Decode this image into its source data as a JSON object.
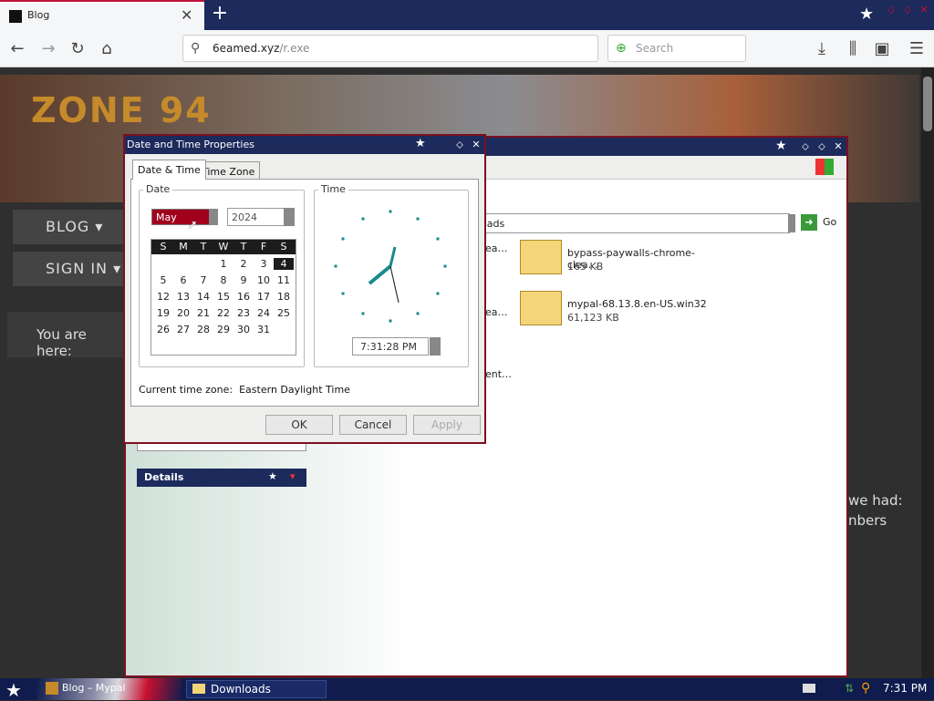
{
  "browser": {
    "tab_title": "Blog",
    "url_host": "6eamed.xyz",
    "url_path": "/r.exe",
    "search_placeholder": "Search"
  },
  "site": {
    "logo": "ZONE 94",
    "nav_blog": "BLOG",
    "nav_signin": "SIGN IN",
    "breadcrumb": "You are here:",
    "side_text_1": "we had:",
    "side_text_2": "nbers"
  },
  "explorer": {
    "address": "oads",
    "go_label": "Go",
    "left_fragment_1": "ea…",
    "left_fragment_2": "ea…",
    "left_fragment_3": "ent…",
    "files": [
      {
        "name": "bypass-paywalls-chrome-clea…",
        "size": "165 KB"
      },
      {
        "name": "mypal-68.13.8.en-US.win32",
        "size": "61,123 KB"
      }
    ],
    "details_label": "Details"
  },
  "dialog": {
    "title": "Date and Time Properties",
    "tabs": [
      "Date & Time",
      "Time Zone"
    ],
    "date_group": "Date",
    "time_group": "Time",
    "month": "May",
    "year": "2024",
    "weekdays": [
      "S",
      "M",
      "T",
      "W",
      "T",
      "F",
      "S"
    ],
    "weeks": [
      [
        "",
        "",
        "",
        "1",
        "2",
        "3",
        "4"
      ],
      [
        "5",
        "6",
        "7",
        "8",
        "9",
        "10",
        "11"
      ],
      [
        "12",
        "13",
        "14",
        "15",
        "16",
        "17",
        "18"
      ],
      [
        "19",
        "20",
        "21",
        "22",
        "23",
        "24",
        "25"
      ],
      [
        "26",
        "27",
        "28",
        "29",
        "30",
        "31",
        ""
      ]
    ],
    "selected_day": "4",
    "time": "7:31:28 PM",
    "timezone_label": "Current time zone:",
    "timezone_value": "Eastern Daylight Time",
    "ok": "OK",
    "cancel": "Cancel",
    "apply": "Apply"
  },
  "taskbar": {
    "task_fragment": "Blog – Mypal",
    "downloads": "Downloads",
    "clock": "7:31 PM"
  },
  "colors": {
    "flag_blue": "#1c2a5c",
    "flag_red": "#c8102e",
    "calendar_selected": "#1c1c1c"
  }
}
